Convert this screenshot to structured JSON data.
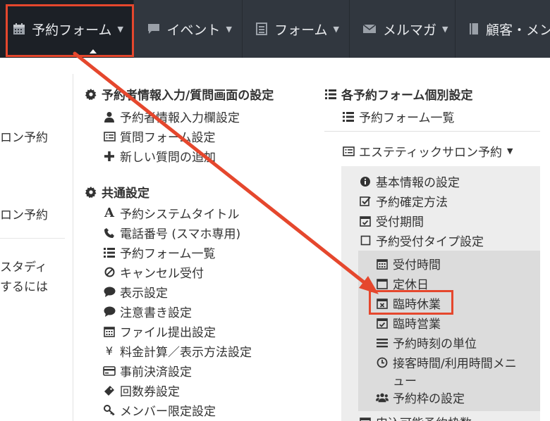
{
  "nav": {
    "items": [
      {
        "label": "予約フォーム",
        "icon": "calendar-icon"
      },
      {
        "label": "イベント",
        "icon": "speech-bubble-icon"
      },
      {
        "label": "フォーム",
        "icon": "list-alt-icon"
      },
      {
        "label": "メルマガ",
        "icon": "envelope-icon"
      },
      {
        "label": "顧客・メン",
        "icon": "book-icon"
      }
    ]
  },
  "left": {
    "lines": [
      "ロン予約",
      "ロン予約",
      "スタディ",
      "するには"
    ]
  },
  "mid": {
    "section1": {
      "header": "予約者情報入力/質問画面の設定",
      "items": [
        "予約者情報入力欄設定",
        "質問フォーム設定",
        "新しい質問の追加"
      ]
    },
    "section2": {
      "header": "共通設定",
      "items": [
        "予約システムタイトル",
        "電話番号 (スマホ専用)",
        "予約フォーム一覧",
        "キャンセル受付",
        "表示設定",
        "注意書き設定",
        "ファイル提出設定",
        "料金計算／表示方法設定",
        "事前決済設定",
        "回数券設定",
        "メンバー限定設定"
      ]
    }
  },
  "right": {
    "header": "各予約フォーム個別設定",
    "list_link": "予約フォーム一覧",
    "form_name": "エステティックサロン予約",
    "items": [
      "基本情報の設定",
      "予約確定方法",
      "受付期間",
      "予約受付タイプ設定"
    ],
    "subitems": [
      "受付時間",
      "定休日",
      "臨時休業",
      "臨時営業",
      "予約時刻の単位",
      "接客時間/利用時間メニ",
      "ュー",
      "予約枠の設定"
    ],
    "cut_off": "申込可能予約枠数"
  },
  "colors": {
    "nav_bg": "#31373f",
    "highlight": "#e5472d",
    "panel": "#ededed",
    "subpanel": "#dcdcdc"
  }
}
